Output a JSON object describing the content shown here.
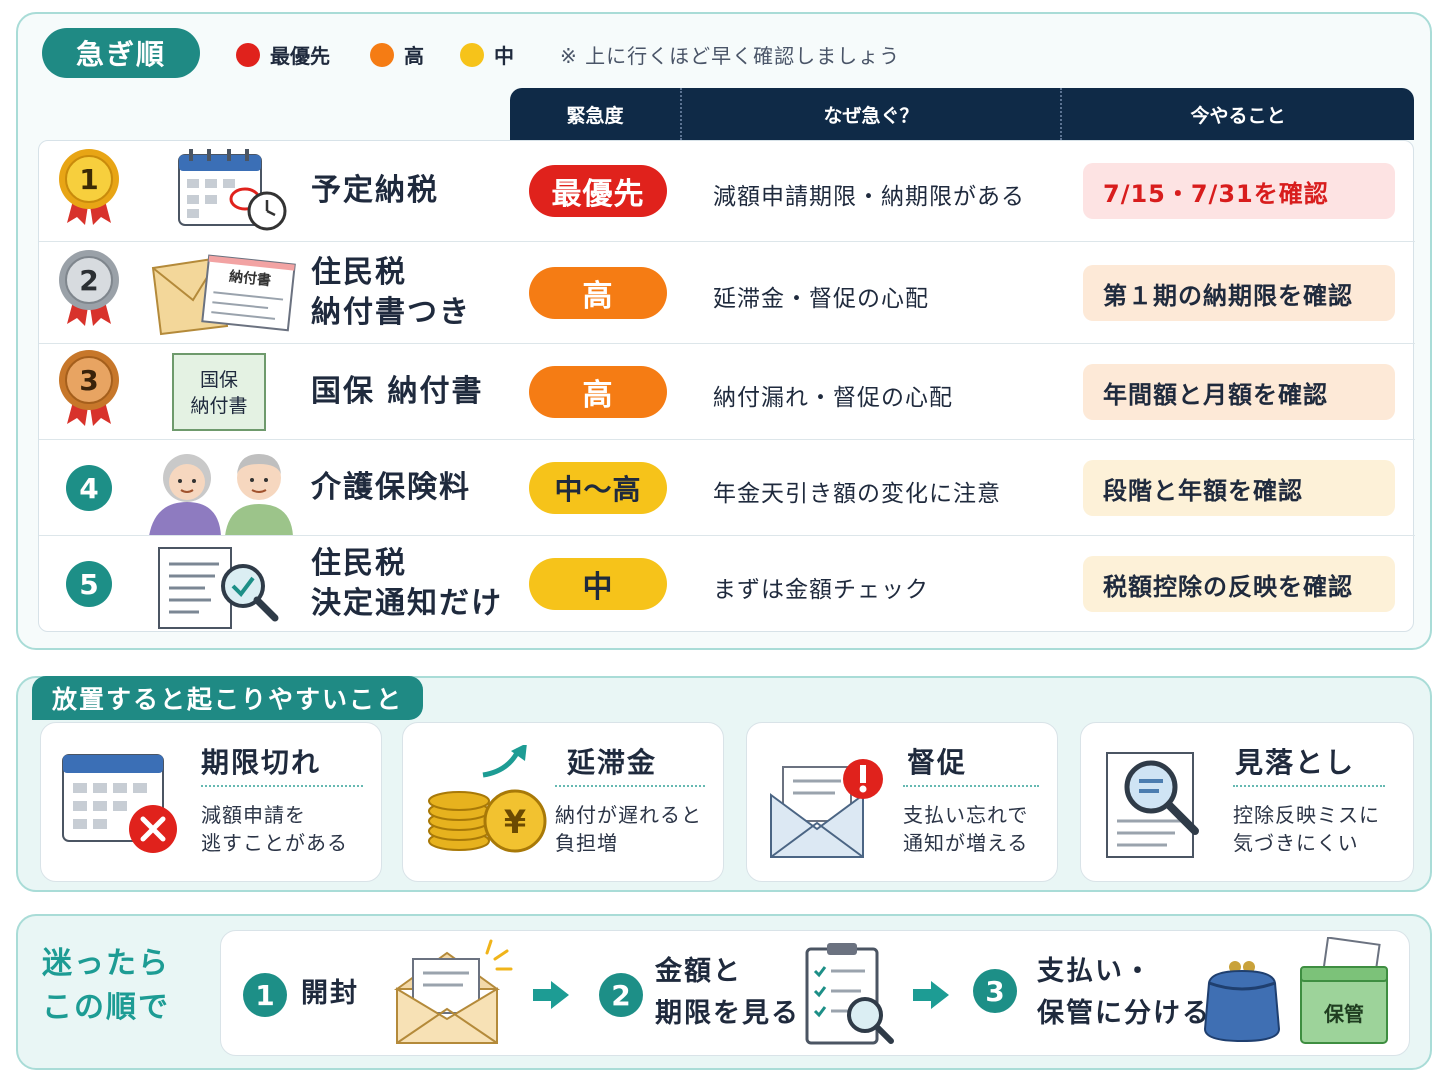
{
  "header": {
    "urgency_label": "急ぎ順",
    "legend": [
      {
        "label": "最優先",
        "color": "#e0221c"
      },
      {
        "label": "高",
        "color": "#f57c14"
      },
      {
        "label": "中",
        "color": "#f6c31a"
      }
    ],
    "note": "※ 上に行くほど早く確認しましょう"
  },
  "table": {
    "columns": [
      "緊急度",
      "なぜ急ぐ？",
      "今やること"
    ],
    "rows": [
      {
        "rank": "1",
        "label": "予定納税",
        "badge": "最優先",
        "badge_color": "#e0221c",
        "badge_text_color": "#ffffff",
        "reason": "減額申請期限・納期限がある",
        "action": "7/15・7/31を確認",
        "action_bg": "#fde3e3",
        "action_color": "#d81d1d",
        "illus_name": "calendar-clock-icon"
      },
      {
        "rank": "2",
        "label": "住民税\n納付書つき",
        "badge": "高",
        "badge_color": "#f57c14",
        "badge_text_color": "#ffffff",
        "reason": "延滞金・督促の心配",
        "action": "第１期の納期限を確認",
        "action_bg": "#fde9d7",
        "action_color": "#1f2a3d",
        "illus_name": "envelope-bill-icon",
        "bill_text": "納付書"
      },
      {
        "rank": "3",
        "label": "国保 納付書",
        "badge": "高",
        "badge_color": "#f57c14",
        "badge_text_color": "#ffffff",
        "reason": "納付漏れ・督促の心配",
        "action": "年間額と月額を確認",
        "action_bg": "#fde9d7",
        "action_color": "#1f2a3d",
        "illus_name": "insurance-slip-icon",
        "slip_text": "国保\n納付書"
      },
      {
        "rank": "4",
        "label": "介護保険料",
        "badge": "中～高",
        "badge_color": "#f6c31a",
        "badge_text_color": "#1f2a3d",
        "reason": "年金天引き額の変化に注意",
        "action": "段階と年額を確認",
        "action_bg": "#fdf1d8",
        "action_color": "#1f2a3d",
        "illus_name": "elderly-couple-icon"
      },
      {
        "rank": "5",
        "label": "住民税\n決定通知だけ",
        "badge": "中",
        "badge_color": "#f6c31a",
        "badge_text_color": "#1f2a3d",
        "reason": "まずは金額チェック",
        "action": "税額控除の反映を確認",
        "action_bg": "#fdf1d8",
        "action_color": "#1f2a3d",
        "illus_name": "document-magnifier-icon"
      }
    ]
  },
  "risks": {
    "title": "放置すると起こりやすいこと",
    "items": [
      {
        "title": "期限切れ",
        "desc": "減額申請を\n逃すことがある",
        "icon": "calendar-cross-icon"
      },
      {
        "title": "延滞金",
        "desc": "納付が遅れると\n負担増",
        "icon": "coins-yen-icon"
      },
      {
        "title": "督促",
        "desc": "支払い忘れで\n通知が増える",
        "icon": "envelope-alert-icon"
      },
      {
        "title": "見落とし",
        "desc": "控除反映ミスに\n気づきにくい",
        "icon": "document-search-icon"
      }
    ]
  },
  "steps": {
    "title": "迷ったら\nこの順で",
    "items": [
      {
        "num": "1",
        "label": "開封",
        "icon": "open-envelope-icon"
      },
      {
        "num": "2",
        "label": "金額と\n期限を見る",
        "icon": "checklist-magnifier-icon"
      },
      {
        "num": "3",
        "label": "支払い・\n保管に分ける",
        "icon": "purse-storage-box-icon",
        "box_text": "保管"
      }
    ]
  },
  "medal_colors": {
    "gold": "#f2b81c",
    "silver": "#bfc4c9",
    "bronze": "#d98a3a"
  }
}
